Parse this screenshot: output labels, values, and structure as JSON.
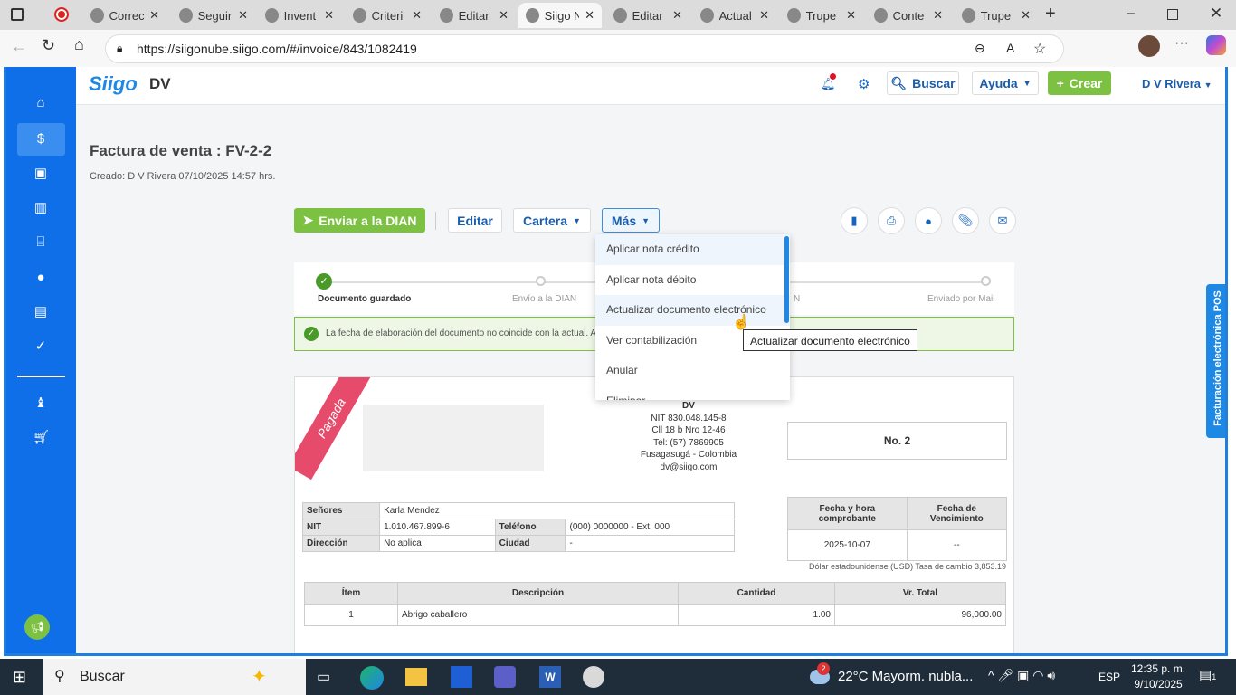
{
  "browser": {
    "tabs": [
      {
        "label": "Correc"
      },
      {
        "label": "Seguir"
      },
      {
        "label": "Invent"
      },
      {
        "label": "Criteri"
      },
      {
        "label": "Editar"
      },
      {
        "label": "Siigo N",
        "active": true
      },
      {
        "label": "Editar"
      },
      {
        "label": "Actual"
      },
      {
        "label": "Trupe"
      },
      {
        "label": "Conte"
      },
      {
        "label": "Trupe"
      }
    ],
    "url": "https://siigonube.siigo.com/#/invoice/843/1082419"
  },
  "header": {
    "logo": "Siigo",
    "company": "DV",
    "search": "Buscar",
    "help": "Ayuda",
    "create": "Crear",
    "user": "D V Rivera"
  },
  "page": {
    "title": "Factura de venta : FV-2-2",
    "created": "Creado: D V Rivera 07/10/2025 14:57 hrs."
  },
  "toolbar": {
    "send": "Enviar a la DIAN",
    "edit": "Editar",
    "wallet": "Cartera",
    "more": "Más"
  },
  "menu": [
    "Aplicar nota crédito",
    "Aplicar nota débito",
    "Actualizar documento electrónico",
    "Ver contabilización",
    "Anular",
    "Eliminar"
  ],
  "tooltip": "Actualizar documento electrónico",
  "steps": [
    "Documento guardado",
    "Envío a la DIAN",
    "N",
    "Enviado por Mail"
  ],
  "alert": "La fecha de elaboración del documento no coincide con la actual. Al en",
  "side_tab": "Facturación electrónica POS",
  "invoice": {
    "ribbon": "Pagada",
    "company": "DV",
    "company_lines": [
      "NIT 830.048.145-8",
      "Cll 18 b Nro 12-46",
      "Tel: (57) 7869905",
      "Fusagasugá - Colombia",
      "dv@siigo.com"
    ],
    "number": "No. 2",
    "client": {
      "senores_label": "Señores",
      "senores": "Karla Mendez",
      "nit_label": "NIT",
      "nit": "1.010.467.899-6",
      "tel_label": "Teléfono",
      "tel": "(000) 0000000 - Ext. 000",
      "dir_label": "Dirección",
      "dir": "No aplica",
      "city_label": "Ciudad",
      "city": "-"
    },
    "dates": {
      "h1": "Fecha y hora comprobante",
      "h2": "Fecha de Vencimiento",
      "d1": "2025-10-07",
      "d2": "--"
    },
    "currency": "Dólar estadounidense (USD) Tasa de cambio 3,853.19",
    "items_headers": [
      "Ítem",
      "Descripción",
      "Cantidad",
      "Vr. Total"
    ],
    "items": [
      [
        "1",
        "Abrigo caballero",
        "1.00",
        "96,000.00"
      ]
    ]
  },
  "taskbar": {
    "search": "Buscar",
    "weather": "22°C  Mayorm. nubla...",
    "weather_badge": "2",
    "lang": "ESP",
    "time": "12:35 p. m.",
    "date": "9/10/2025",
    "notif": "1"
  }
}
